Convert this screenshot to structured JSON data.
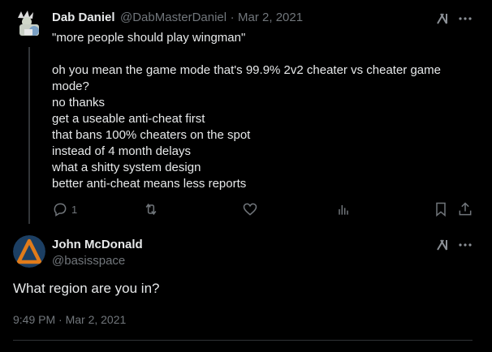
{
  "tweet1": {
    "display_name": "Dab Daniel",
    "handle": "@DabMasterDaniel",
    "separator": "·",
    "date": "Mar 2, 2021",
    "text": "\"more people should play wingman\"\n\noh you mean the game mode that's 99.9% 2v2 cheater vs cheater game mode?\nno thanks\nget a useable anti-cheat first\nthat bans 100% cheaters on the spot\ninstead of 4 month delays\nwhat a shitty system design\nbetter anti-cheat means less reports",
    "reply_count": "1",
    "icons": [
      "grok-icon",
      "more-icon",
      "reply-icon",
      "retweet-icon",
      "like-icon",
      "views-icon",
      "bookmark-icon",
      "share-icon"
    ]
  },
  "tweet2": {
    "display_name": "John McDonald",
    "handle": "@basisspace",
    "text": "What region are you in?",
    "timestamp": "9:49 PM · Mar 2, 2021",
    "avatar_colors": {
      "background": "#1c3f63",
      "triangle": "#e07b1a"
    }
  },
  "colors": {
    "background": "#000000",
    "text": "#e7e9ea",
    "secondary": "#71767b",
    "divider": "#2f3336"
  }
}
